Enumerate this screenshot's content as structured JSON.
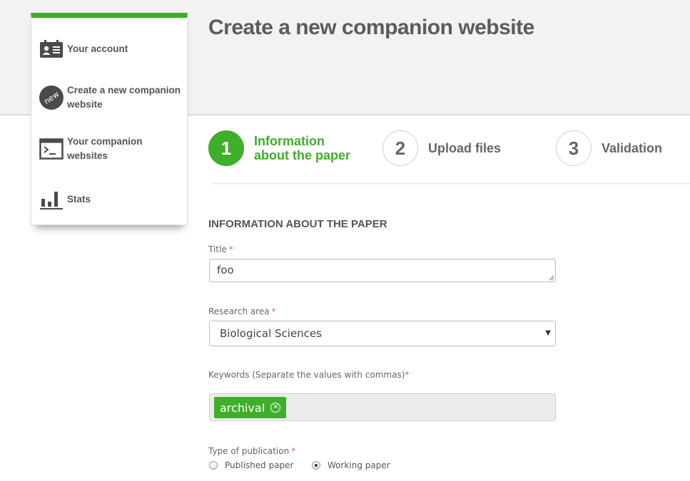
{
  "page": {
    "title": "Create a new companion website",
    "accent_color": "#3fae2a"
  },
  "sidebar": {
    "items": [
      {
        "label": "Your account",
        "icon": "id-card-icon"
      },
      {
        "label": "Create a new companion website",
        "icon": "new-badge-icon",
        "badge_text": "new"
      },
      {
        "label": "Your companion websites",
        "icon": "terminal-window-icon"
      },
      {
        "label": "Stats",
        "icon": "bar-chart-icon"
      }
    ]
  },
  "steps": [
    {
      "number": "1",
      "label": "Information about the paper",
      "active": true
    },
    {
      "number": "2",
      "label": "Upload files",
      "active": false
    },
    {
      "number": "3",
      "label": "Validation",
      "active": false
    }
  ],
  "form": {
    "section_title": "INFORMATION ABOUT THE PAPER",
    "required_marker": "*",
    "title_label": "Title",
    "title_value": "foo",
    "research_area_label": "Research area",
    "research_area_value": "Biological Sciences",
    "keywords_label": "Keywords (Separate the values with commas)",
    "keywords": [
      "archival"
    ],
    "publication_type_label": "Type of publication",
    "publication_types": [
      {
        "label": "Published paper",
        "checked": false
      },
      {
        "label": "Working paper",
        "checked": true
      }
    ]
  }
}
